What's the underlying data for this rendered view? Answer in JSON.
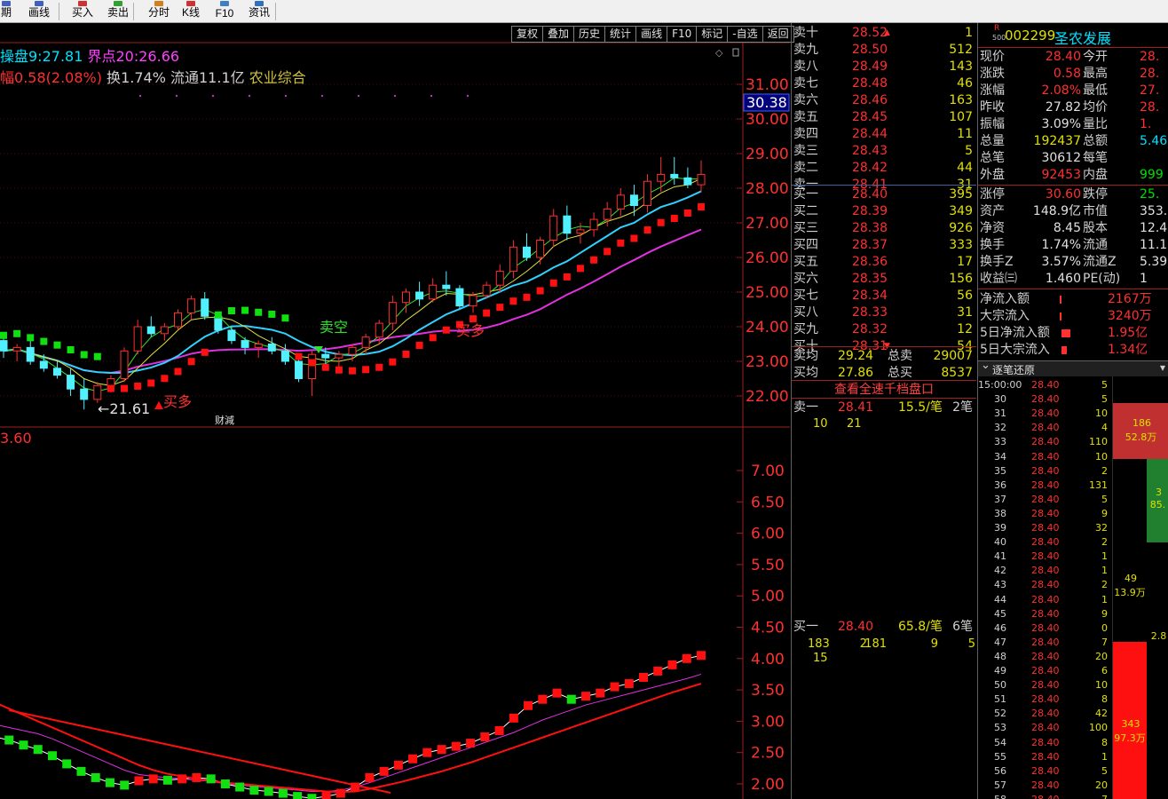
{
  "toolbar": {
    "items": [
      {
        "label": "期",
        "icon": "period-icon"
      },
      {
        "label": "画线",
        "icon": "draw-line-icon"
      },
      {
        "label": "买入",
        "icon": "buy-icon"
      },
      {
        "label": "卖出",
        "icon": "sell-icon"
      },
      {
        "label": "分时",
        "icon": "timeshare-icon"
      },
      {
        "label": "K线",
        "icon": "kline-icon"
      },
      {
        "label": "F10",
        "icon": "f10-icon"
      },
      {
        "label": "资讯",
        "icon": "news-icon"
      }
    ]
  },
  "chart_tabs": [
    "复权",
    "叠加",
    "历史",
    "统计",
    "画线",
    "F10",
    "标记",
    "-自选",
    "返回"
  ],
  "info": {
    "caopan_label": "操盘9:",
    "caopan_value": "27.81",
    "jiedian_label": "界点20:",
    "jiedian_value": "26.66",
    "change_prefix": "幅",
    "change_value": "0.58(2.08%)",
    "turnover_label": "换",
    "turnover_value": "1.74%",
    "float_label": "流通",
    "float_value": "11.1亿",
    "sector": "农业综合"
  },
  "chart_labels": {
    "sell_empty": "卖空",
    "buy_more_1": "买多",
    "buy_more_2": "买多",
    "low_price": "←21.61",
    "news_tag": "财減",
    "current_price_tag": "30.38",
    "lower_value": "3.60"
  },
  "chart_data": [
    {
      "type": "candlestick",
      "title": "",
      "ylim": [
        21.6,
        31.3
      ],
      "y_ticks": [
        "31.00",
        "30.00",
        "29.00",
        "28.00",
        "27.00",
        "26.00",
        "25.00",
        "24.00",
        "23.00",
        "22.00"
      ],
      "ohlc": [
        [
          23.6,
          23.8,
          23.1,
          23.3
        ],
        [
          23.3,
          23.5,
          23.0,
          23.4
        ],
        [
          23.4,
          23.6,
          22.9,
          23.0
        ],
        [
          23.0,
          23.2,
          22.7,
          22.8
        ],
        [
          22.8,
          23.0,
          22.5,
          22.6
        ],
        [
          22.6,
          22.8,
          22.0,
          22.2
        ],
        [
          22.2,
          22.5,
          21.61,
          21.9
        ],
        [
          21.9,
          22.4,
          21.8,
          22.3
        ],
        [
          22.3,
          22.6,
          22.1,
          22.5
        ],
        [
          22.5,
          23.4,
          22.4,
          23.3
        ],
        [
          23.3,
          24.2,
          23.2,
          24.0
        ],
        [
          24.0,
          24.3,
          23.7,
          23.8
        ],
        [
          23.8,
          24.1,
          23.6,
          24.0
        ],
        [
          24.0,
          24.5,
          23.9,
          24.4
        ],
        [
          24.4,
          24.9,
          24.2,
          24.8
        ],
        [
          24.8,
          25.0,
          24.2,
          24.3
        ],
        [
          24.3,
          24.4,
          23.8,
          23.9
        ],
        [
          23.9,
          24.0,
          23.5,
          23.6
        ],
        [
          23.6,
          23.7,
          23.2,
          23.4
        ],
        [
          23.4,
          23.6,
          23.1,
          23.5
        ],
        [
          23.5,
          23.7,
          23.2,
          23.3
        ],
        [
          23.3,
          23.5,
          22.9,
          23.0
        ],
        [
          23.0,
          23.2,
          22.4,
          22.5
        ],
        [
          22.5,
          23.3,
          22.0,
          23.2
        ],
        [
          23.2,
          23.4,
          22.9,
          23.1
        ],
        [
          23.1,
          23.3,
          22.8,
          23.2
        ],
        [
          23.2,
          23.5,
          23.0,
          23.4
        ],
        [
          23.4,
          23.8,
          23.2,
          23.7
        ],
        [
          23.7,
          24.2,
          23.5,
          24.1
        ],
        [
          24.1,
          24.9,
          23.9,
          24.7
        ],
        [
          24.7,
          25.1,
          24.4,
          25.0
        ],
        [
          25.0,
          25.3,
          24.6,
          24.8
        ],
        [
          24.8,
          25.4,
          24.7,
          25.2
        ],
        [
          25.2,
          25.6,
          24.9,
          25.1
        ],
        [
          25.1,
          25.2,
          24.5,
          24.6
        ],
        [
          24.6,
          25.0,
          24.4,
          24.9
        ],
        [
          24.9,
          25.3,
          24.8,
          25.2
        ],
        [
          25.2,
          25.8,
          25.0,
          25.6
        ],
        [
          25.6,
          26.5,
          25.4,
          26.3
        ],
        [
          26.3,
          26.7,
          25.9,
          26.0
        ],
        [
          26.0,
          26.6,
          25.8,
          26.5
        ],
        [
          26.5,
          27.4,
          26.3,
          27.2
        ],
        [
          27.2,
          27.5,
          26.5,
          26.7
        ],
        [
          26.7,
          27.0,
          26.4,
          26.8
        ],
        [
          26.8,
          27.3,
          26.6,
          27.1
        ],
        [
          27.1,
          27.6,
          26.9,
          27.4
        ],
        [
          27.4,
          28.0,
          27.2,
          27.8
        ],
        [
          27.8,
          28.1,
          27.2,
          27.5
        ],
        [
          27.5,
          28.4,
          27.3,
          28.2
        ],
        [
          28.2,
          28.9,
          27.9,
          28.4
        ],
        [
          28.4,
          28.9,
          28.1,
          28.3
        ],
        [
          28.3,
          28.6,
          28.0,
          28.1
        ],
        [
          28.1,
          28.8,
          27.9,
          28.4
        ]
      ]
    },
    {
      "type": "line",
      "title": "",
      "ylim": [
        1.8,
        7.6
      ],
      "y_ticks": [
        "7.00",
        "6.50",
        "6.00",
        "5.50",
        "5.00",
        "4.50",
        "4.00",
        "3.50",
        "3.00",
        "2.50",
        "2.00"
      ],
      "series": [
        {
          "values": [
            2.75,
            2.7,
            2.62,
            2.55,
            2.45,
            2.32,
            2.2,
            2.1,
            2.02,
            1.98,
            2.05,
            2.08,
            2.06,
            2.08,
            2.1,
            2.08,
            2.0,
            1.95,
            1.9,
            1.88,
            1.85,
            1.8,
            1.77,
            1.8,
            1.85,
            1.95,
            2.1,
            2.2,
            2.3,
            2.4,
            2.5,
            2.55,
            2.6,
            2.65,
            2.75,
            2.85,
            3.05,
            3.25,
            3.35,
            3.45,
            3.35,
            3.4,
            3.45,
            3.55,
            3.6,
            3.7,
            3.8,
            3.9,
            4.0,
            4.05
          ]
        },
        {
          "values": [
            2.95,
            2.9,
            2.85,
            2.8,
            2.72,
            2.62,
            2.52,
            2.42,
            2.32,
            2.22,
            2.15,
            2.12,
            2.1,
            2.08,
            2.06,
            2.04,
            2.0,
            1.98,
            1.96,
            1.94,
            1.92,
            1.9,
            1.88,
            1.88,
            1.9,
            1.95,
            2.02,
            2.1,
            2.18,
            2.26,
            2.34,
            2.42,
            2.5,
            2.58,
            2.66,
            2.74,
            2.82,
            2.92,
            3.02,
            3.1,
            3.18,
            3.26,
            3.32,
            3.38,
            3.44,
            3.5,
            3.56,
            3.62,
            3.68,
            3.75
          ]
        },
        {
          "values": [
            3.3,
            3.2,
            3.1,
            3.0,
            2.9,
            2.8,
            2.7,
            2.6,
            2.5,
            2.4,
            2.3,
            2.22,
            2.16,
            2.12,
            2.08,
            2.05,
            2.02,
            2.0,
            1.98,
            1.96,
            1.94,
            1.92,
            1.9,
            1.88,
            1.87,
            1.88,
            1.92,
            1.97,
            2.02,
            2.08,
            2.14,
            2.2,
            2.27,
            2.34,
            2.42,
            2.5,
            2.58,
            2.66,
            2.74,
            2.82,
            2.9,
            2.98,
            3.06,
            3.14,
            3.22,
            3.3,
            3.38,
            3.46,
            3.53,
            3.6
          ]
        }
      ]
    }
  ],
  "order_book": {
    "asks": [
      {
        "label": "卖十",
        "price": "28.52",
        "vol": "1",
        "arrow": "▲"
      },
      {
        "label": "卖九",
        "price": "28.50",
        "vol": "512"
      },
      {
        "label": "卖八",
        "price": "28.49",
        "vol": "143"
      },
      {
        "label": "卖七",
        "price": "28.48",
        "vol": "46"
      },
      {
        "label": "卖六",
        "price": "28.46",
        "vol": "163"
      },
      {
        "label": "卖五",
        "price": "28.45",
        "vol": "107"
      },
      {
        "label": "卖四",
        "price": "28.44",
        "vol": "11"
      },
      {
        "label": "卖三",
        "price": "28.43",
        "vol": "5"
      },
      {
        "label": "卖二",
        "price": "28.42",
        "vol": "44"
      },
      {
        "label": "卖一",
        "price": "28.41",
        "vol": "31"
      }
    ],
    "bids": [
      {
        "label": "买一",
        "price": "28.40",
        "vol": "395"
      },
      {
        "label": "买二",
        "price": "28.39",
        "vol": "349"
      },
      {
        "label": "买三",
        "price": "28.38",
        "vol": "926"
      },
      {
        "label": "买四",
        "price": "28.37",
        "vol": "333"
      },
      {
        "label": "买五",
        "price": "28.36",
        "vol": "17"
      },
      {
        "label": "买六",
        "price": "28.35",
        "vol": "156"
      },
      {
        "label": "买七",
        "price": "28.34",
        "vol": "56"
      },
      {
        "label": "买八",
        "price": "28.33",
        "vol": "31"
      },
      {
        "label": "买九",
        "price": "28.32",
        "vol": "12"
      },
      {
        "label": "买十",
        "price": "28.31",
        "vol": "54",
        "arrow": "▼"
      }
    ],
    "summary": [
      {
        "label": "卖均",
        "price": "29.24",
        "label2": "总卖",
        "vol": "29007"
      },
      {
        "label": "买均",
        "price": "27.86",
        "label2": "总买",
        "vol": "8537"
      }
    ],
    "full_depth_link": "查看全速千档盘口",
    "ask1_detail": {
      "label": "卖一",
      "price": "28.41",
      "avg": "15.5/笔",
      "count": "2笔",
      "orders": [
        "10",
        "21"
      ]
    },
    "bid1_detail": {
      "label": "买一",
      "price": "28.40",
      "avg": "65.8/笔",
      "count": "6笔",
      "orders": [
        "183",
        "2",
        "181",
        "9",
        "5",
        "15"
      ]
    }
  },
  "quote": {
    "code_prefix": "R",
    "code_sub": "500",
    "code": "002299",
    "name": "圣农发展",
    "rows": [
      {
        "l": "现价",
        "v": "28.40",
        "vc": "red",
        "l2": "今开",
        "v2": "28.",
        "v2c": "red"
      },
      {
        "l": "涨跌",
        "v": "0.58",
        "vc": "red",
        "l2": "最高",
        "v2": "28.",
        "v2c": "red"
      },
      {
        "l": "涨幅",
        "v": "2.08%",
        "vc": "red",
        "l2": "最低",
        "v2": "27.",
        "v2c": "red"
      },
      {
        "l": "昨收",
        "v": "27.82",
        "vc": "white",
        "l2": "均价",
        "v2": "28.",
        "v2c": "red"
      },
      {
        "l": "振幅",
        "v": "3.09%",
        "vc": "white",
        "l2": "量比",
        "v2": "1.",
        "v2c": "red"
      },
      {
        "l": "总量",
        "v": "192437",
        "vc": "yellow",
        "l2": "总额",
        "v2": "5.46",
        "v2c": "cyan"
      },
      {
        "l": "总笔",
        "v": "30612",
        "vc": "white",
        "l2": "每笔",
        "v2": "",
        "v2c": "white"
      },
      {
        "l": "外盘",
        "v": "92453",
        "vc": "red",
        "l2": "内盘",
        "v2": "999",
        "v2c": "green"
      },
      {
        "l": "涨停",
        "v": "30.60",
        "vc": "red",
        "l2": "跌停",
        "v2": "25.",
        "v2c": "green"
      },
      {
        "l": "资产",
        "v": "148.9亿",
        "vc": "white",
        "l2": "市值",
        "v2": "353.3",
        "v2c": "white"
      },
      {
        "l": "净资",
        "v": "8.45",
        "vc": "white",
        "l2": "股本",
        "v2": "12.4",
        "v2c": "white"
      },
      {
        "l": "换手",
        "v": "1.74%",
        "vc": "white",
        "l2": "流通",
        "v2": "11.1",
        "v2c": "white"
      },
      {
        "l": "换手Z",
        "v": "3.57%",
        "vc": "white",
        "l2": "流通Z",
        "v2": "5.39",
        "v2c": "white"
      },
      {
        "l": "收益㈢",
        "v": "1.460",
        "vc": "white",
        "l2": "PE(动)",
        "v2": "1",
        "v2c": "white"
      }
    ],
    "flows": [
      {
        "l": "净流入额",
        "v": "2167万",
        "v2": "",
        "bar": 2
      },
      {
        "l": "大宗流入",
        "v": "3240万",
        "v2": "",
        "bar": 2
      },
      {
        "l": "5日净流入额",
        "v": "1.95亿",
        "v2": "",
        "bar": 10
      },
      {
        "l": "5日大宗流入",
        "v": "1.34亿",
        "v2": "",
        "bar": 6
      }
    ],
    "tick_header": "逐笔还原",
    "ticks": [
      {
        "t": "15:00:00",
        "p": "28.40",
        "v": "5"
      },
      {
        "t": "30",
        "p": "28.40",
        "v": "5"
      },
      {
        "t": "31",
        "p": "28.40",
        "v": "10"
      },
      {
        "t": "32",
        "p": "28.40",
        "v": "4"
      },
      {
        "t": "33",
        "p": "28.40",
        "v": "110"
      },
      {
        "t": "34",
        "p": "28.40",
        "v": "10"
      },
      {
        "t": "35",
        "p": "28.40",
        "v": "2"
      },
      {
        "t": "36",
        "p": "28.40",
        "v": "131"
      },
      {
        "t": "37",
        "p": "28.40",
        "v": "5"
      },
      {
        "t": "38",
        "p": "28.40",
        "v": "9"
      },
      {
        "t": "39",
        "p": "28.40",
        "v": "32"
      },
      {
        "t": "40",
        "p": "28.40",
        "v": "2"
      },
      {
        "t": "41",
        "p": "28.40",
        "v": "1"
      },
      {
        "t": "42",
        "p": "28.40",
        "v": "1"
      },
      {
        "t": "43",
        "p": "28.40",
        "v": "2"
      },
      {
        "t": "44",
        "p": "28.40",
        "v": "1"
      },
      {
        "t": "45",
        "p": "28.40",
        "v": "9"
      },
      {
        "t": "46",
        "p": "28.40",
        "v": "0"
      },
      {
        "t": "47",
        "p": "28.40",
        "v": "7"
      },
      {
        "t": "48",
        "p": "28.40",
        "v": "20"
      },
      {
        "t": "49",
        "p": "28.40",
        "v": "6"
      },
      {
        "t": "50",
        "p": "28.40",
        "v": "10"
      },
      {
        "t": "51",
        "p": "28.40",
        "v": "8"
      },
      {
        "t": "52",
        "p": "28.40",
        "v": "42"
      },
      {
        "t": "53",
        "p": "28.40",
        "v": "100"
      },
      {
        "t": "54",
        "p": "28.40",
        "v": "8"
      },
      {
        "t": "55",
        "p": "28.40",
        "v": "1"
      },
      {
        "t": "56",
        "p": "28.40",
        "v": "5"
      },
      {
        "t": "57",
        "p": "28.40",
        "v": "20"
      },
      {
        "t": "58",
        "p": "28.40",
        "v": "7"
      }
    ],
    "blocks": [
      {
        "top": "186",
        "bot": "52.8万",
        "color": "#c03030",
        "tv": "10"
      },
      {
        "top": "3",
        "bot": "85.",
        "color": "#208030",
        "tv": "131"
      },
      {
        "top": "49",
        "bot": "13.9万",
        "color": "#000000",
        "tv": "9"
      },
      {
        "top": "2.8",
        "bot": "",
        "color": "#000000",
        "tv": ""
      },
      {
        "top": "343",
        "bot": "97.3万",
        "color": "#ff1010",
        "tv": "8"
      }
    ]
  }
}
